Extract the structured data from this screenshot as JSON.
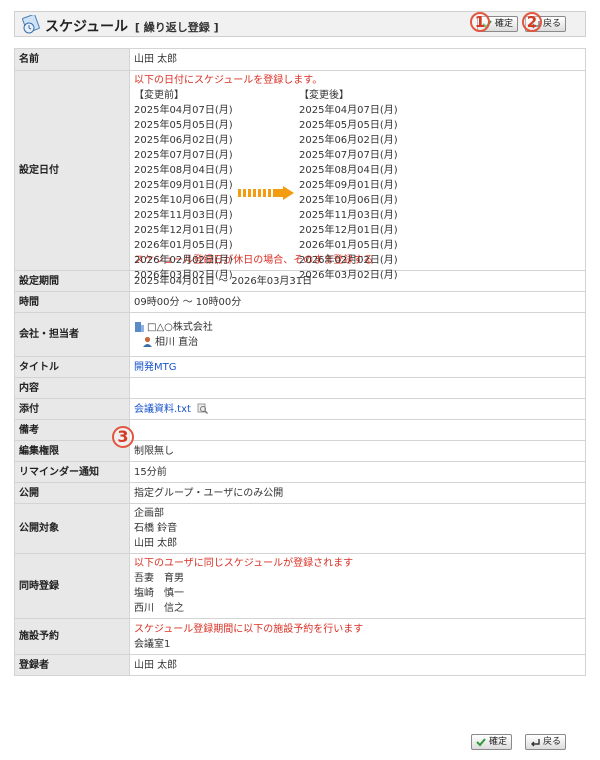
{
  "header": {
    "title": "スケジュール",
    "subtitle": "[ 繰り返し登録 ]"
  },
  "buttons": {
    "confirm": "確定",
    "back": "戻る"
  },
  "markers": [
    "1",
    "2",
    "3"
  ],
  "rows": {
    "name": {
      "label": "名前",
      "value": "山田 太郎"
    },
    "dates": {
      "label": "設定日付",
      "notice": "以下の日付にスケジュールを登録します。",
      "before_header": "【変更前】",
      "after_header": "【変更後】",
      "before": [
        "2025年04月07日(月)",
        "2025年05月05日(月)",
        "2025年06月02日(月)",
        "2025年07月07日(月)",
        "2025年08月04日(月)",
        "2025年09月01日(月)",
        "2025年10月06日(月)",
        "2025年11月03日(月)",
        "2025年12月01日(月)",
        "2026年01月05日(月)",
        "2026年02月02日(月)",
        "2026年03月02日(月)"
      ],
      "after": [
        "2025年04月07日(月)",
        "2025年05月05日(月)",
        "2025年06月02日(月)",
        "2025年07月07日(月)",
        "2025年08月04日(月)",
        "2025年09月01日(月)",
        "2025年10月06日(月)",
        "2025年11月03日(月)",
        "2025年12月01日(月)",
        "2026年01月05日(月)",
        "2026年02月02日(月)",
        "2026年03月02日(月)"
      ],
      "holiday_note": "スケジュール登録日が休日の場合、そのまま登録する"
    },
    "period": {
      "label": "設定期間",
      "value": "2025年04月01日 ～ 2026年03月31日"
    },
    "time": {
      "label": "時間",
      "value": "09時00分 ～ 10時00分"
    },
    "company": {
      "label": "会社・担当者",
      "company": "□△○株式会社",
      "person": "相川 直治"
    },
    "title": {
      "label": "タイトル",
      "value": "開発MTG"
    },
    "content": {
      "label": "内容",
      "value": ""
    },
    "attachment": {
      "label": "添付",
      "value": "会議資料.txt"
    },
    "remarks": {
      "label": "備考",
      "value": ""
    },
    "permission": {
      "label": "編集権限",
      "value": "制限無し"
    },
    "reminder": {
      "label": "リマインダー通知",
      "value": "15分前"
    },
    "public": {
      "label": "公開",
      "value": "指定グループ・ユーザにのみ公開"
    },
    "targets": {
      "label": "公開対象",
      "values": [
        "企画部",
        "石橋 鈴音",
        "山田 太郎"
      ]
    },
    "simultaneous": {
      "label": "同時登録",
      "notice": "以下のユーザに同じスケジュールが登録されます",
      "users": [
        "吾妻　育男",
        "塩崎　慎一",
        "西川　信之"
      ]
    },
    "facility": {
      "label": "施設予約",
      "notice": "スケジュール登録期間に以下の施設予約を行います",
      "value": "会議室1"
    },
    "registrant": {
      "label": "登録者",
      "value": "山田 太郎"
    }
  },
  "colors": {
    "label_bg": "#e8e8e8",
    "red": "#d93025",
    "link": "#1a55cc",
    "arrow": "#f39c12"
  }
}
